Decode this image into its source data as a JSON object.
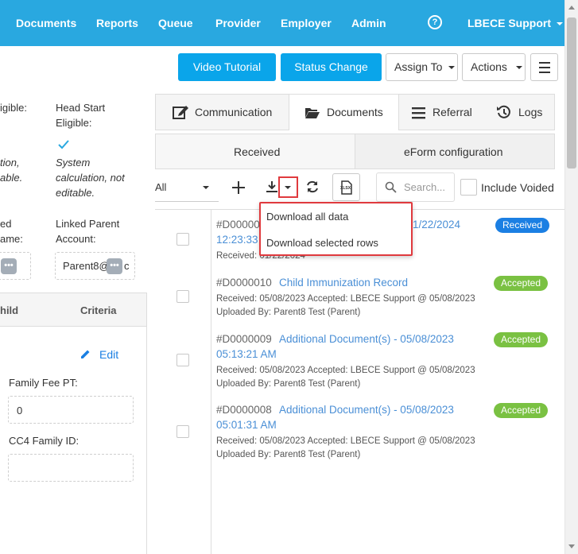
{
  "nav": {
    "items": [
      "Documents",
      "Reports",
      "Queue",
      "Provider",
      "Employer",
      "Admin"
    ],
    "help": "?",
    "user": "LBECE Support"
  },
  "actions": {
    "video_tutorial": "Video Tutorial",
    "status_change": "Status Change",
    "assign_to": "Assign To",
    "actions": "Actions"
  },
  "left": {
    "eligible_partial": "igible:",
    "head_start_line1": "Head Start",
    "head_start_line2": "Eligible:",
    "calc_partial1": "tion,",
    "calc_partial2": "able.",
    "system_calc1": "System",
    "system_calc2": "calculation, not",
    "system_calc3": "editable.",
    "linked_partial1": "ed",
    "linked_partial2": "ame:",
    "linked_parent1": "Linked Parent",
    "linked_parent2": "Account:",
    "linked_parent_value": "Parent8@",
    "linked_parent_tail": "c",
    "col_child": "hild",
    "col_criteria": "Criteria",
    "edit": "Edit",
    "family_fee_label": "Family Fee PT:",
    "family_fee_value": "0",
    "cc4_label": "CC4 Family ID:",
    "cc4_value": ""
  },
  "tabs": {
    "communication": "Communication",
    "documents": "Documents",
    "referral": "Referral",
    "logs": "Logs",
    "received": "Received",
    "eform": "eForm configuration"
  },
  "toolbar": {
    "filter_value": "All",
    "search_placeholder": "Search...",
    "include_voided": "Include Voided",
    "xlsx": "XLSX"
  },
  "download_menu": {
    "all": "Download all data",
    "selected": "Download selected rows"
  },
  "documents": [
    {
      "id": "#D00000",
      "title_tail": "1/22/2024",
      "title_line2": "12:23:33",
      "meta1": "Received: 01/22/2024",
      "meta2": "",
      "status": "Received"
    },
    {
      "id": "#D0000010",
      "title": "Child Immunization Record",
      "meta1": "Received: 05/08/2023 Accepted: LBECE Support @ 05/08/2023",
      "meta2": "Uploaded By: Parent8 Test (Parent)",
      "status": "Accepted"
    },
    {
      "id": "#D0000009",
      "title": "Additional Document(s) - 05/08/2023",
      "title_line2": "05:13:21 AM",
      "meta1": "Received: 05/08/2023 Accepted: LBECE Support @ 05/08/2023",
      "meta2": "Uploaded By: Parent8 Test (Parent)",
      "status": "Accepted"
    },
    {
      "id": "#D0000008",
      "title": "Additional Document(s) - 05/08/2023",
      "title_line2": "05:01:31 AM",
      "meta1": "Received: 05/08/2023 Accepted: LBECE Support @ 05/08/2023",
      "meta2": "Uploaded By: Parent8 Test (Parent)",
      "status": "Accepted"
    }
  ],
  "colors": {
    "nav_bg": "#29a8e0",
    "button_blue": "#0aa5ea",
    "accepted": "#7ac142",
    "received": "#1b7fe3",
    "link": "#4a8fd6",
    "highlight": "#e03a3e"
  }
}
